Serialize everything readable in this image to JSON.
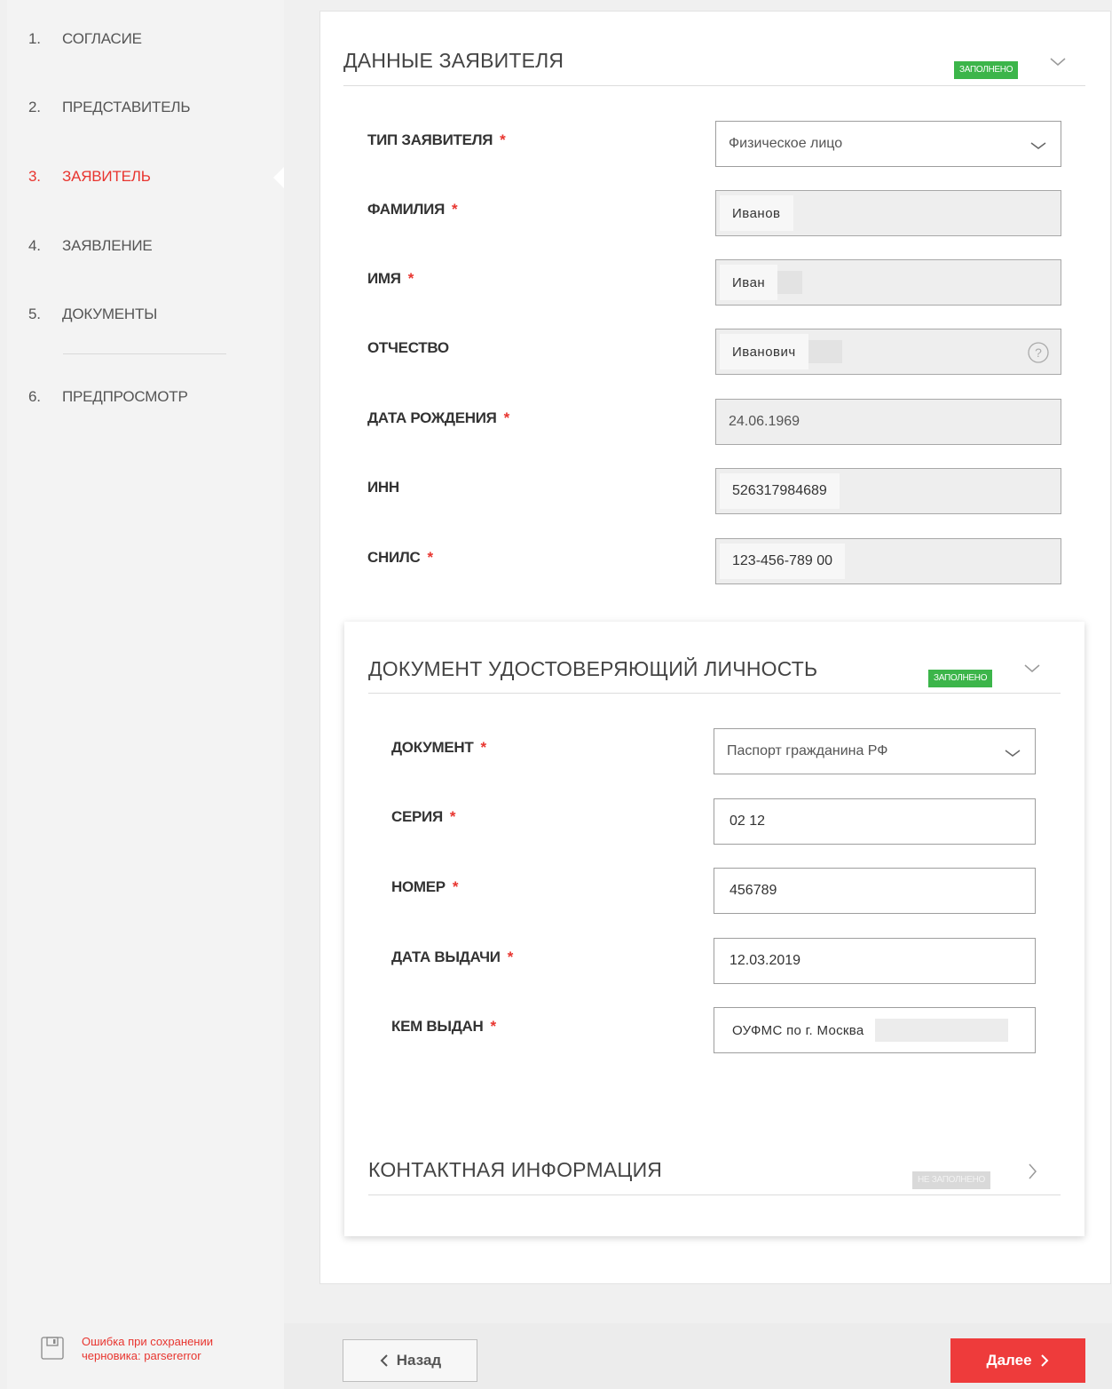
{
  "steps": [
    {
      "num": "1.",
      "label": "СОГЛАСИЕ"
    },
    {
      "num": "2.",
      "label": "ПРЕДСТАВИТЕЛЬ"
    },
    {
      "num": "3.",
      "label": "ЗАЯВИТЕЛЬ"
    },
    {
      "num": "4.",
      "label": "ЗАЯВЛЕНИЕ"
    },
    {
      "num": "5.",
      "label": "ДОКУМЕНТЫ"
    },
    {
      "num": "6.",
      "label": "ПРЕДПРОСМОТР"
    }
  ],
  "save_error": "Ошибка при сохранении черновика: parsererror",
  "applicant": {
    "title": "ДАННЫЕ ЗАЯВИТЕЛЯ",
    "badge": "ЗАПОЛНЕНО",
    "fields": {
      "type": {
        "label": "ТИП ЗАЯВИТЕЛЯ",
        "value": "Физическое лицо"
      },
      "surname": {
        "label": "ФАМИЛИЯ",
        "value": "Иванов"
      },
      "name": {
        "label": "ИМЯ",
        "value": "Иван"
      },
      "patronymic": {
        "label": "ОТЧЕСТВО",
        "value": "Иванович"
      },
      "birthdate": {
        "label": "ДАТА РОЖДЕНИЯ",
        "value": "24.06.1969"
      },
      "inn": {
        "label": "ИНН",
        "value": "526317984689"
      },
      "snils": {
        "label": "СНИЛС",
        "value": "123-456-789 00"
      }
    }
  },
  "identity_doc": {
    "title": "ДОКУМЕНТ УДОСТОВЕРЯЮЩИЙ ЛИЧНОСТЬ",
    "badge": "ЗАПОЛНЕНО",
    "fields": {
      "document": {
        "label": "ДОКУМЕНТ",
        "value": "Паспорт гражданина РФ"
      },
      "series": {
        "label": "СЕРИЯ",
        "value": "02 12"
      },
      "number": {
        "label": "НОМЕР",
        "value": "456789"
      },
      "issue_date": {
        "label": "ДАТА ВЫДАЧИ",
        "value": "12.03.2019"
      },
      "issued_by": {
        "label": "КЕМ ВЫДАН",
        "value": "ОУФМС по г. Москва"
      }
    }
  },
  "contact": {
    "title": "КОНТАКТНАЯ ИНФОРМАЦИЯ",
    "badge": "НЕ ЗАПОЛНЕНО"
  },
  "required_mark": "*",
  "buttons": {
    "back": "Назад",
    "next": "Далее"
  },
  "colors": {
    "accent": "#e8352f",
    "filled": "#3cb54a",
    "unfilled": "#d9d9d9"
  }
}
